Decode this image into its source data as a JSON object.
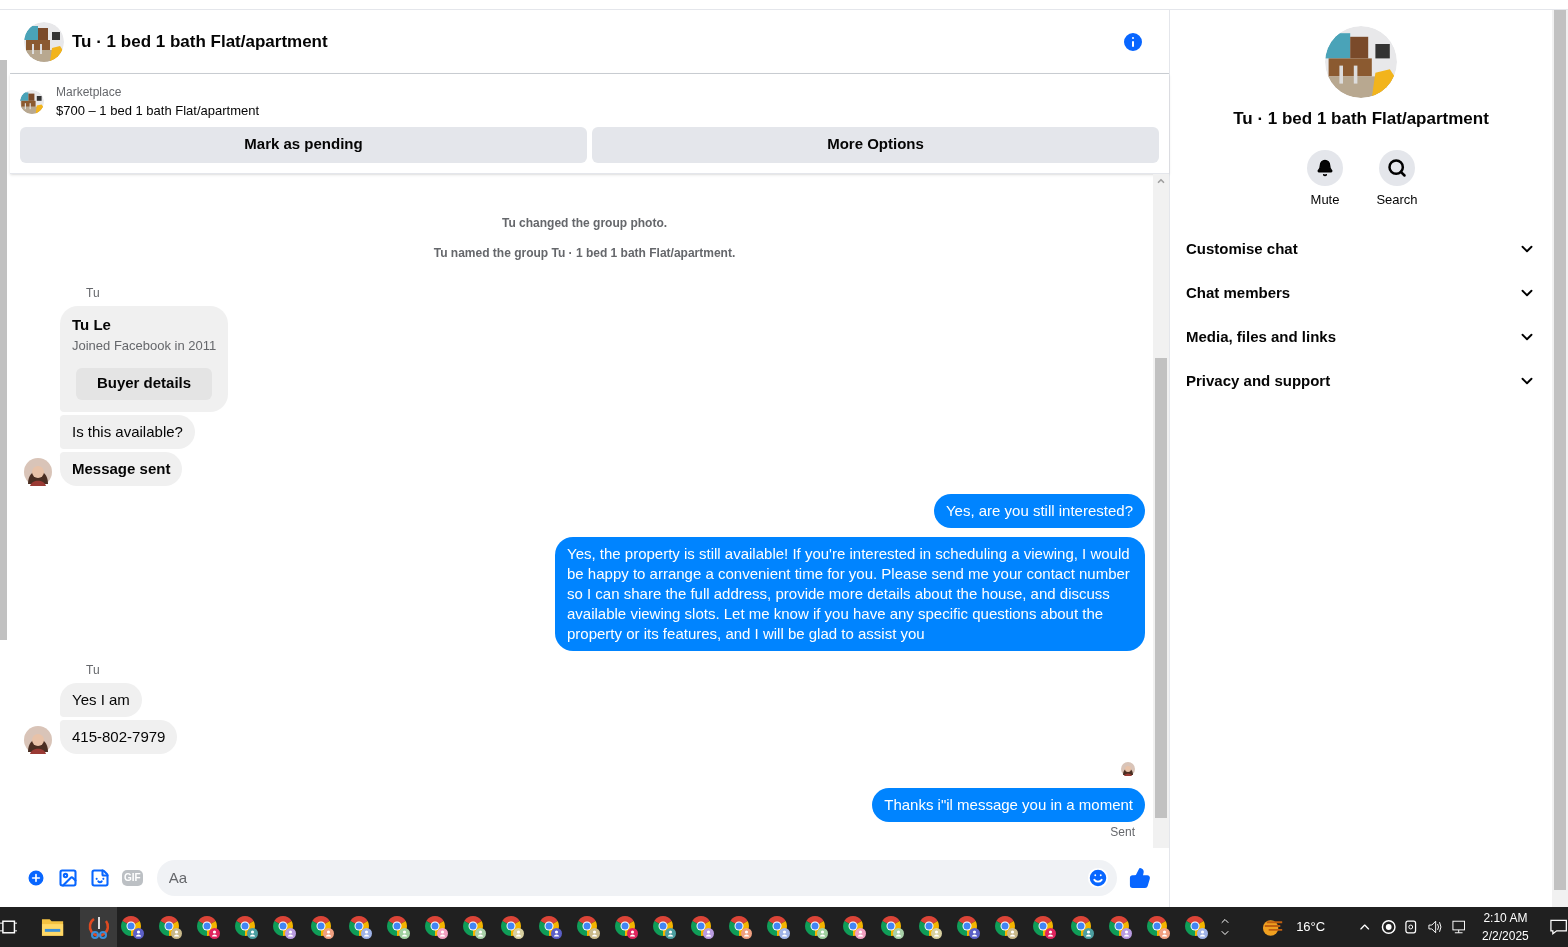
{
  "header": {
    "title": "Tu · 1 bed 1 bath Flat/apartment"
  },
  "listing": {
    "source": "Marketplace",
    "title": "$700 – 1 bed 1 bath Flat/apartment",
    "buttons": [
      "Mark as pending",
      "More Options"
    ]
  },
  "messages": [
    {
      "kind": "system",
      "text": "Tu changed the group photo."
    },
    {
      "kind": "system",
      "text": "Tu named the group Tu · 1 bed 1 bath Flat/apartment."
    },
    {
      "kind": "incoming",
      "sender": "Tu",
      "items": [
        {
          "kind": "card",
          "name": "Tu Le",
          "subtitle": "Joined Facebook in 2011",
          "button": "Buyer details"
        },
        {
          "kind": "text",
          "text": "Is this available?",
          "bold": false
        },
        {
          "kind": "text",
          "text": "Message sent",
          "bold": true
        }
      ]
    },
    {
      "kind": "outgoing",
      "items": [
        {
          "kind": "text",
          "text": "Yes, are you still interested?"
        },
        {
          "kind": "text",
          "text": "Yes, the property is still available! If you're interested in scheduling a viewing, I would be happy to arrange a convenient time for you. Please send me your contact number so I can share the full address, provide more details about the house, and discuss available viewing slots. Let me know if you have any specific questions about the property or its features, and I will be glad to assist you"
        }
      ]
    },
    {
      "kind": "incoming",
      "sender": "Tu",
      "items": [
        {
          "kind": "text",
          "text": "Yes I am",
          "bold": false
        },
        {
          "kind": "text",
          "text": "415-802-7979",
          "bold": false
        }
      ]
    },
    {
      "kind": "outgoing",
      "seen": true,
      "status": "Sent",
      "items": [
        {
          "kind": "text",
          "text": "Thanks i\"il message you in a moment"
        }
      ]
    }
  ],
  "composer": {
    "placeholder": "Aa",
    "gif": "GIF"
  },
  "details": {
    "title": "Tu · 1 bed 1 bath Flat/apartment",
    "actions": [
      {
        "kind": "mute",
        "label": "Mute"
      },
      {
        "kind": "search",
        "label": "Search"
      }
    ],
    "sections": [
      {
        "label": "Customise chat",
        "expanded": false
      },
      {
        "label": "Chat members",
        "expanded": false
      },
      {
        "label": "Media, files and links",
        "expanded": false
      },
      {
        "label": "Privacy and support",
        "expanded": false
      }
    ]
  },
  "taskbar": {
    "temperature": "16°C",
    "time": "2:10 AM",
    "date": "2/2/2025"
  }
}
